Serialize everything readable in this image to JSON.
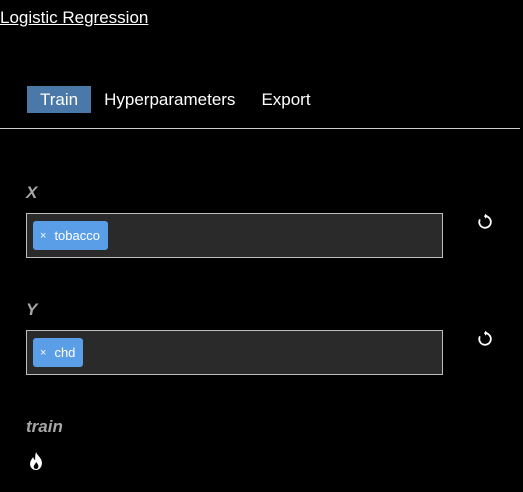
{
  "app": {
    "title": "Logistic Regression"
  },
  "tabs": [
    {
      "label": "Train",
      "active": true
    },
    {
      "label": "Hyperparameters",
      "active": false
    },
    {
      "label": "Export",
      "active": false
    }
  ],
  "fields": {
    "x": {
      "label": "X",
      "chips": [
        {
          "remove_glyph": "×",
          "label": "tobacco"
        }
      ],
      "reset_icon": "reset-icon"
    },
    "y": {
      "label": "Y",
      "chips": [
        {
          "remove_glyph": "×",
          "label": "chd"
        }
      ],
      "reset_icon": "reset-icon"
    }
  },
  "train": {
    "label": "train",
    "icon": "fire-icon"
  },
  "colors": {
    "background": "#000000",
    "tab_active": "#4a78a8",
    "chip": "#5a9ee8",
    "input_bg": "#2a2a2a",
    "label": "#a6a6a6"
  }
}
